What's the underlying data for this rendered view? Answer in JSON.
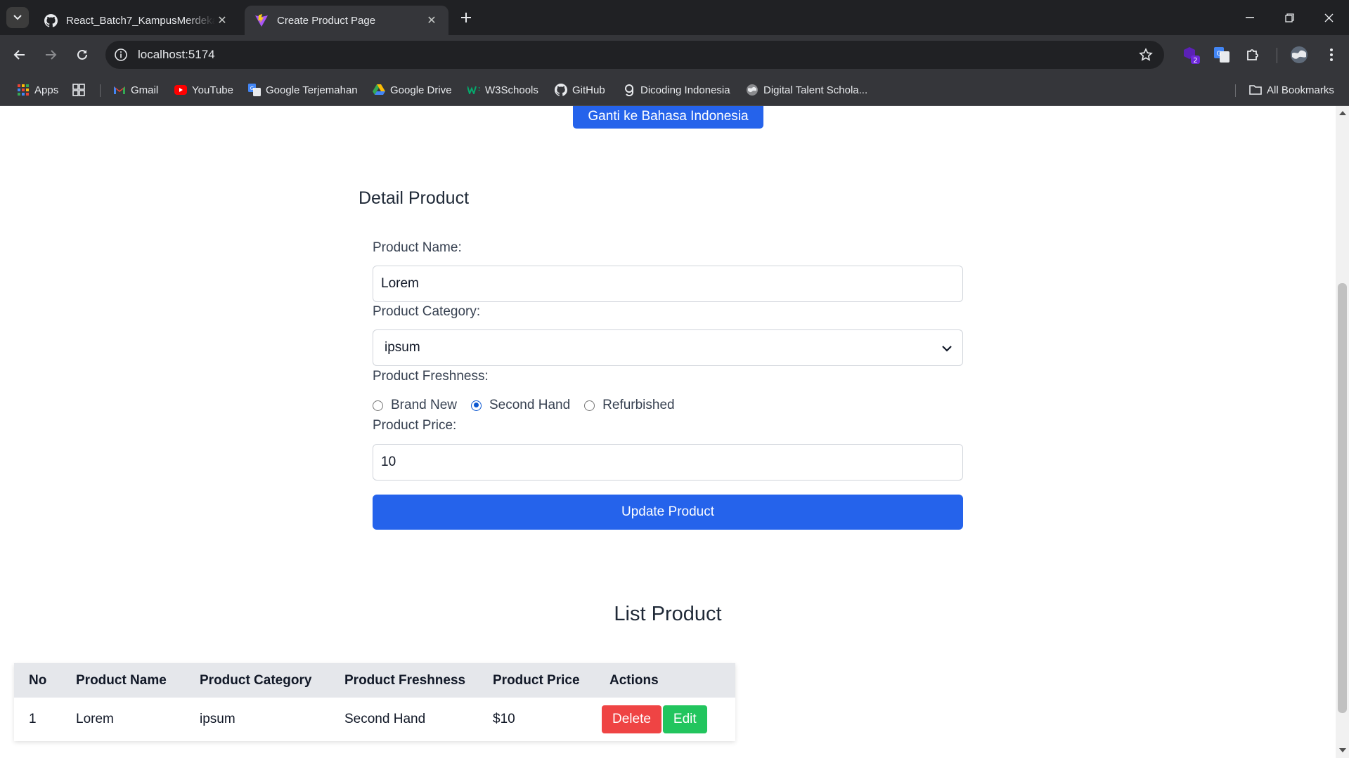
{
  "browser": {
    "tabs": [
      {
        "title": "React_Batch7_KampusMerdeka_",
        "icon": "github-icon",
        "active": false
      },
      {
        "title": "Create Product Page",
        "icon": "vite-icon",
        "active": true
      }
    ],
    "url": "localhost:5174",
    "extension_badge": "2",
    "bookmarks": [
      {
        "label": "Apps",
        "icon": "apps-grid-icon"
      },
      {
        "label": "Gmail",
        "icon": "gmail-icon"
      },
      {
        "label": "YouTube",
        "icon": "youtube-icon"
      },
      {
        "label": "Google Terjemahan",
        "icon": "google-translate-icon"
      },
      {
        "label": "Google Drive",
        "icon": "google-drive-icon"
      },
      {
        "label": "W3Schools",
        "icon": "w3schools-icon"
      },
      {
        "label": "GitHub",
        "icon": "github-icon"
      },
      {
        "label": "Dicoding Indonesia",
        "icon": "dicoding-icon"
      },
      {
        "label": "Digital Talent Schola...",
        "icon": "globe-icon"
      }
    ],
    "all_bookmarks": "All Bookmarks"
  },
  "page": {
    "language_button": "Ganti ke Bahasa Indonesia",
    "form": {
      "title": "Detail Product",
      "name_label": "Product Name:",
      "name_value": "Lorem",
      "category_label": "Product Category:",
      "category_value": "ipsum",
      "freshness_label": "Product Freshness:",
      "freshness_options": [
        "Brand New",
        "Second Hand",
        "Refurbished"
      ],
      "freshness_selected": "Second Hand",
      "price_label": "Product Price:",
      "price_value": "10",
      "submit_label": "Update Product"
    },
    "list": {
      "title": "List Product",
      "columns": [
        "No",
        "Product Name",
        "Product Category",
        "Product Freshness",
        "Product Price",
        "Actions"
      ],
      "rows": [
        {
          "no": "1",
          "name": "Lorem",
          "category": "ipsum",
          "freshness": "Second Hand",
          "price": "$10",
          "delete_label": "Delete",
          "edit_label": "Edit"
        }
      ]
    }
  },
  "colors": {
    "primary": "#2563eb",
    "danger": "#ef4444",
    "success": "#22c55e",
    "table_header": "#e5e7eb"
  }
}
